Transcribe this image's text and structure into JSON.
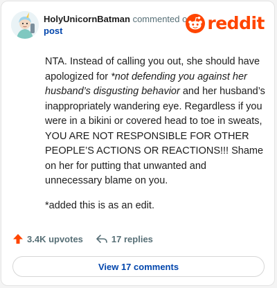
{
  "header": {
    "username": "HolyUnicornBatman",
    "commented_text": " commented on",
    "post_link": "post",
    "logo_word": "reddit"
  },
  "comment": {
    "p1_a": "NTA. Instead of calling you out, she should have apologized for ",
    "p1_em": "*not defending you against her husband’s disgusting behavior",
    "p1_b": " and her husband’s inappropriately wandering eye. Regardless if you were in a bikini or covered head to toe in sweats, YOU ARE NOT RESPONSIBLE FOR OTHER PEOPLE’S ACTIONS OR REACTIONS!!! Shame on her for putting that unwanted and unnecessary blame on you.",
    "p2": "*added this is as an edit."
  },
  "footer": {
    "upvotes": "3.4K upvotes",
    "replies": "17 replies"
  },
  "view_button": "View 17 comments",
  "icons": {
    "upvote": "upvote-arrow-icon",
    "reply": "reply-arrow-icon",
    "logo": "reddit-snoo-icon",
    "avatar": "user-avatar"
  },
  "colors": {
    "brand": "#ff4500",
    "link": "#0045ac",
    "muted": "#576f76"
  }
}
